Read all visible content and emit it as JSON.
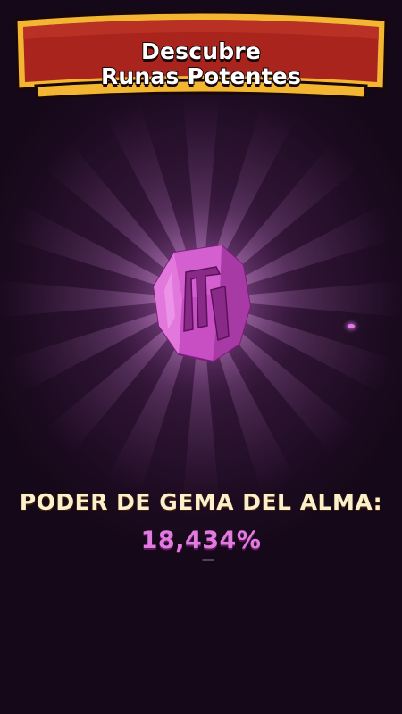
{
  "banner": {
    "line1": "Descubre",
    "line2": "Runas Potentes"
  },
  "gem": {
    "icon": "soul-gem-icon",
    "color": "#d85ad2"
  },
  "power": {
    "label": "PODER DE GEMA DEL ALMA:",
    "value": "18,434%"
  },
  "colors": {
    "background": "#1a0c1e",
    "banner_red": "#a8241c",
    "banner_gold": "#f2b632",
    "label_cream": "#fbf0c8",
    "value_pink": "#e27adf"
  }
}
